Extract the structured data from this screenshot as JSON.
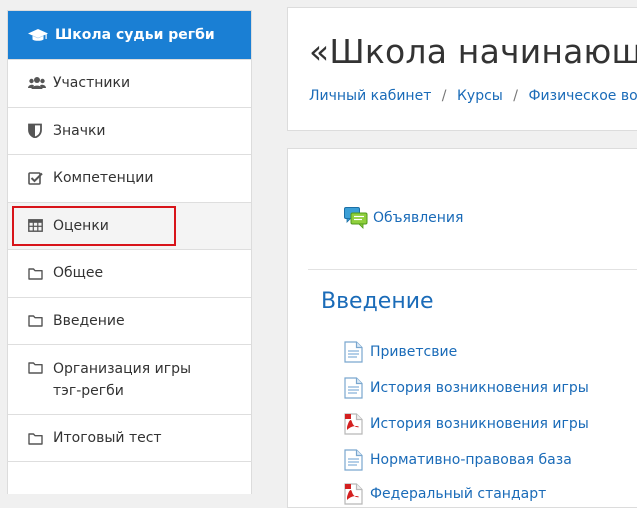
{
  "sidebar": {
    "header": "Школа судьи регби",
    "items": [
      {
        "label": "Участники",
        "icon": "users-icon"
      },
      {
        "label": "Значки",
        "icon": "shield-icon"
      },
      {
        "label": "Компетенции",
        "icon": "checkbox-icon"
      },
      {
        "label": "Оценки",
        "icon": "table-icon"
      },
      {
        "label": "Общее",
        "icon": "folder-icon"
      },
      {
        "label": "Введение",
        "icon": "folder-icon"
      },
      {
        "label": "Организация игры тэг-регби",
        "icon": "folder-icon"
      },
      {
        "label": "Итоговый тест",
        "icon": "folder-icon"
      }
    ]
  },
  "header": {
    "title": "«Школа начинающе",
    "breadcrumb": [
      "Личный кабинет",
      "Курсы",
      "Физическое воспи"
    ]
  },
  "content": {
    "announcements": "Объявления",
    "section_title": "Введение",
    "activities": [
      {
        "label": "Приветсвие",
        "icon": "page-icon"
      },
      {
        "label": "История возникновения игры",
        "icon": "page-icon"
      },
      {
        "label": "История возникновения игры",
        "icon": "pdf-icon"
      },
      {
        "label": "Нормативно-правовая база",
        "icon": "page-icon"
      },
      {
        "label": "Федеральный стандарт",
        "icon": "pdf-icon"
      }
    ]
  },
  "colors": {
    "accent": "#1a7fd4",
    "link": "#1a6bb8",
    "highlight_border": "#d8141a"
  }
}
